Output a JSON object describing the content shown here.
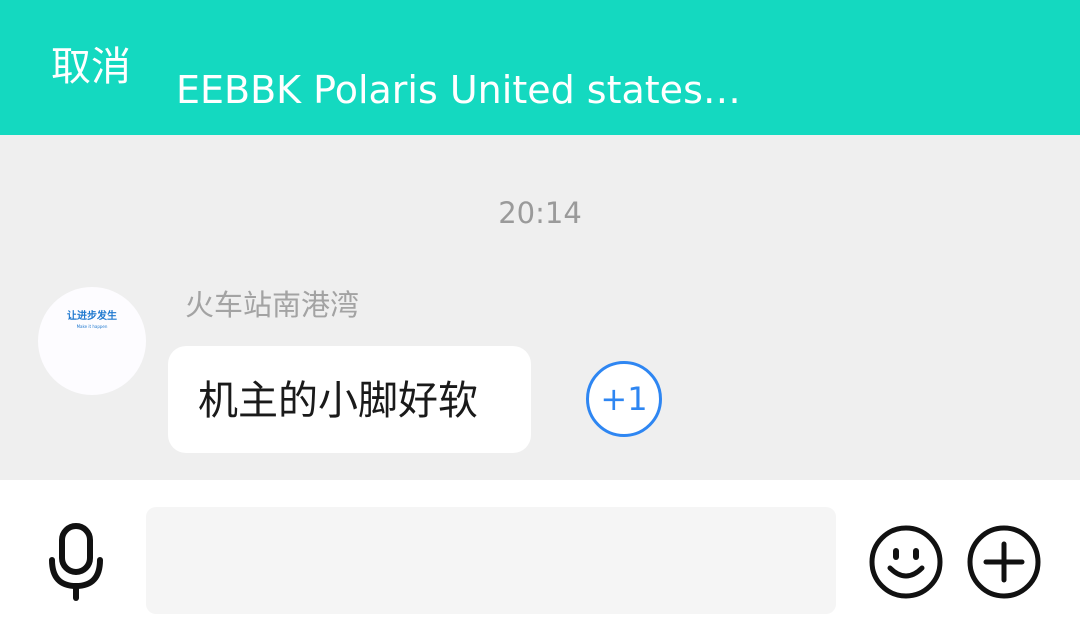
{
  "header": {
    "cancel_label": "取消",
    "title": "EEBBK Polaris United states…"
  },
  "chat": {
    "timestamp": "20:14",
    "messages": [
      {
        "sender": "火车站南港湾",
        "text": "机主的小脚好软",
        "reaction_label": "+1",
        "avatar": {
          "line1": "让进步发生",
          "line2": "Make it happen"
        }
      }
    ]
  },
  "input_bar": {
    "text_value": "",
    "icons": [
      "microphone-icon",
      "emoji-icon",
      "plus-icon"
    ]
  },
  "colors": {
    "header_bg": "#14d9c0",
    "chat_bg": "#efefef",
    "accent_blue": "#2e86f2"
  }
}
